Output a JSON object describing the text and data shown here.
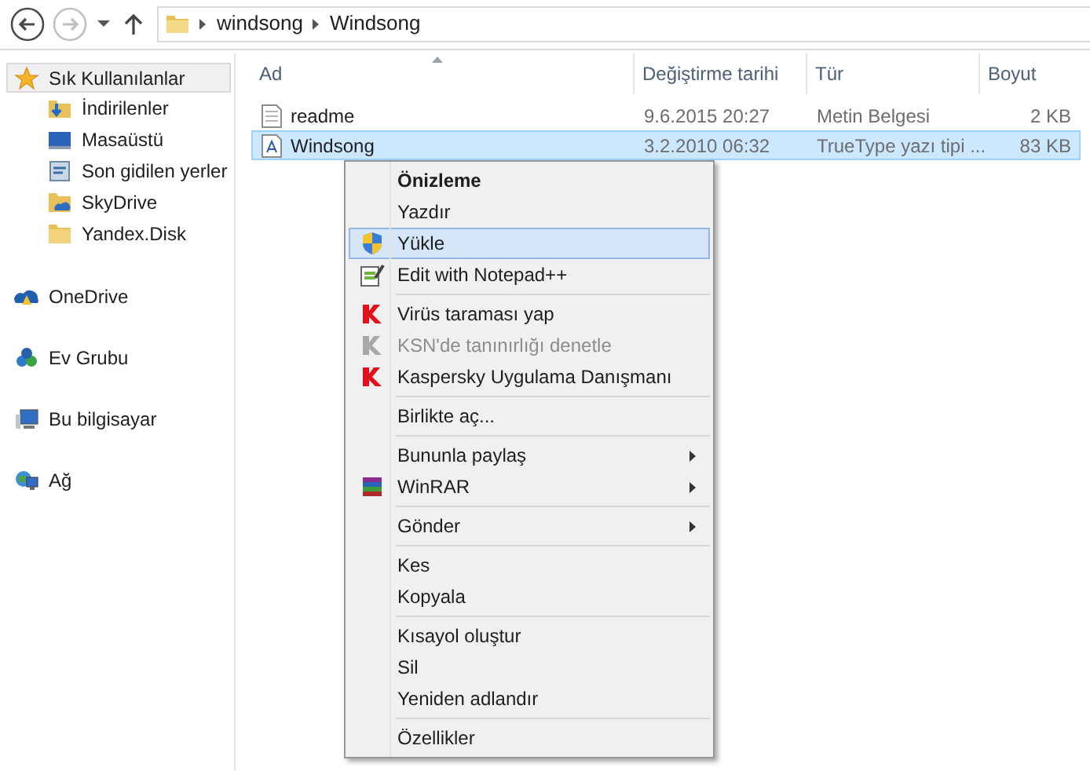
{
  "toolbar": {
    "back_disabled": false,
    "forward_disabled": true
  },
  "address_bar": {
    "segments": [
      "windsong",
      "Windsong"
    ]
  },
  "sidebar": {
    "sections": [
      {
        "label": "Sık Kullanılanlar",
        "kind": "star",
        "selected": true,
        "children": [
          {
            "label": "İndirilenler",
            "kind": "downloads"
          },
          {
            "label": "Masaüstü",
            "kind": "desktop"
          },
          {
            "label": "Son gidilen yerler",
            "kind": "recent"
          },
          {
            "label": "SkyDrive",
            "kind": "cloudfolder"
          },
          {
            "label": "Yandex.Disk",
            "kind": "folder"
          }
        ]
      },
      {
        "label": "OneDrive",
        "kind": "onedrive",
        "selected": false
      },
      {
        "label": "Ev Grubu",
        "kind": "homegroup",
        "selected": false
      },
      {
        "label": "Bu bilgisayar",
        "kind": "computer",
        "selected": false
      },
      {
        "label": "Ağ",
        "kind": "network",
        "selected": false
      }
    ]
  },
  "table": {
    "columns": [
      "Ad",
      "Değiştirme tarihi",
      "Tür",
      "Boyut"
    ],
    "rows": [
      {
        "kind": "text",
        "name": "readme",
        "date": "9.6.2015 20:27",
        "type": "Metin Belgesi",
        "size": "2 KB",
        "selected": false
      },
      {
        "kind": "font",
        "name": "Windsong",
        "date": "3.2.2010 06:32",
        "type": "TrueType yazı tipi ...",
        "size": "83 KB",
        "selected": true
      }
    ]
  },
  "context_menu": {
    "items": [
      {
        "kind": "plain",
        "label": "Önizleme",
        "bold": true,
        "selected": false,
        "disabled": false,
        "submenu": false
      },
      {
        "kind": "plain",
        "label": "Yazdır",
        "bold": false,
        "selected": false,
        "disabled": false,
        "submenu": false
      },
      {
        "kind": "shield",
        "label": "Yükle",
        "bold": false,
        "selected": true,
        "disabled": false,
        "submenu": false
      },
      {
        "kind": "notepad",
        "label": "Edit with Notepad++",
        "bold": false,
        "selected": false,
        "disabled": false,
        "submenu": false
      },
      {
        "kind": "separator"
      },
      {
        "kind": "kaspersky",
        "label": "Virüs taraması yap",
        "bold": false,
        "selected": false,
        "disabled": false,
        "submenu": false
      },
      {
        "kind": "kaspersky",
        "label": "KSN'de tanınırlığı denetle",
        "bold": false,
        "selected": false,
        "disabled": true,
        "submenu": false
      },
      {
        "kind": "kaspersky",
        "label": "Kaspersky Uygulama Danışmanı",
        "bold": false,
        "selected": false,
        "disabled": false,
        "submenu": false
      },
      {
        "kind": "separator"
      },
      {
        "kind": "plain",
        "label": "Birlikte aç...",
        "bold": false,
        "selected": false,
        "disabled": false,
        "submenu": false
      },
      {
        "kind": "separator"
      },
      {
        "kind": "plain",
        "label": "Bununla paylaş",
        "bold": false,
        "selected": false,
        "disabled": false,
        "submenu": true
      },
      {
        "kind": "winrar",
        "label": "WinRAR",
        "bold": false,
        "selected": false,
        "disabled": false,
        "submenu": true
      },
      {
        "kind": "separator"
      },
      {
        "kind": "plain",
        "label": "Gönder",
        "bold": false,
        "selected": false,
        "disabled": false,
        "submenu": true
      },
      {
        "kind": "separator"
      },
      {
        "kind": "plain",
        "label": "Kes",
        "bold": false,
        "selected": false,
        "disabled": false,
        "submenu": false
      },
      {
        "kind": "plain",
        "label": "Kopyala",
        "bold": false,
        "selected": false,
        "disabled": false,
        "submenu": false
      },
      {
        "kind": "separator"
      },
      {
        "kind": "plain",
        "label": "Kısayol oluştur",
        "bold": false,
        "selected": false,
        "disabled": false,
        "submenu": false
      },
      {
        "kind": "plain",
        "label": "Sil",
        "bold": false,
        "selected": false,
        "disabled": false,
        "submenu": false
      },
      {
        "kind": "plain",
        "label": "Yeniden adlandır",
        "bold": false,
        "selected": false,
        "disabled": false,
        "submenu": false
      },
      {
        "kind": "separator"
      },
      {
        "kind": "plain",
        "label": "Özellikler",
        "bold": false,
        "selected": false,
        "disabled": false,
        "submenu": false
      }
    ]
  }
}
